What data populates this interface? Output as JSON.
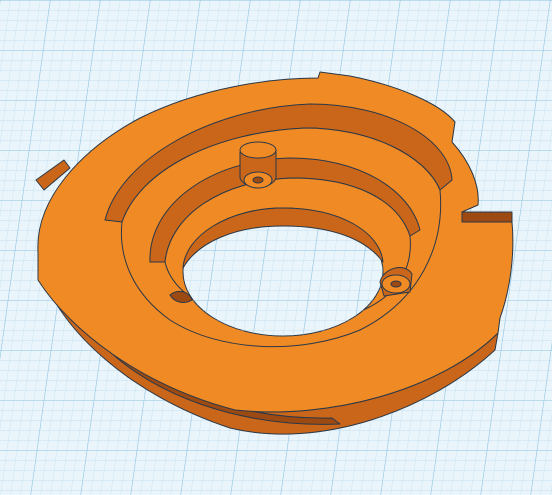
{
  "viewport": {
    "kind": "3d-design-workplane",
    "grid": true,
    "grid_color": "#b6d8ec",
    "grid_major_color": "#8ec3e2",
    "background_color": "#eaf5fb"
  },
  "model": {
    "shape": "stepped-ring-adapter",
    "color": "#f08a24",
    "shade_color": "#c9661a",
    "dark_color": "#9c4a12",
    "outline_color": "#2a3848",
    "features": [
      "center-hole",
      "raised-inner-step",
      "two-screw-bosses",
      "split-slot",
      "edge-notches"
    ]
  }
}
